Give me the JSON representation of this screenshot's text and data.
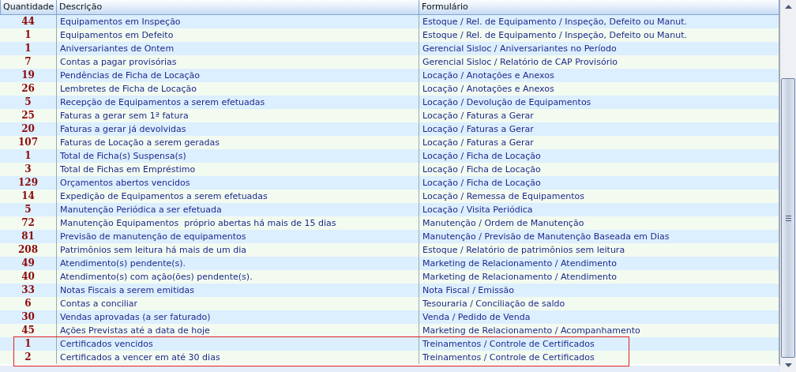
{
  "table": {
    "columns": [
      "Quantidade",
      "Descrição",
      "Formulário"
    ],
    "rows": [
      {
        "quantity": "44",
        "description": "Equipamentos em Inspeção",
        "form": "Estoque / Rel. de Equipamento / Inspeção, Defeito ou Manut.",
        "outlined": false
      },
      {
        "quantity": "1",
        "description": "Equipamentos em Defeito",
        "form": "Estoque / Rel. de Equipamento / Inspeção, Defeito ou Manut.",
        "outlined": false
      },
      {
        "quantity": "1",
        "description": "Aniversariantes de Ontem",
        "form": "Gerencial Sisloc / Aniversariantes no Período",
        "outlined": false
      },
      {
        "quantity": "7",
        "description": "Contas a pagar provisórias",
        "form": "Gerencial Sisloc / Relatório de CAP Provisório",
        "outlined": false
      },
      {
        "quantity": "19",
        "description": "Pendências de Ficha de Locação",
        "form": "Locação / Anotações e Anexos",
        "outlined": false
      },
      {
        "quantity": "26",
        "description": "Lembretes de Ficha de Locação",
        "form": "Locação / Anotações e Anexos",
        "outlined": false
      },
      {
        "quantity": "5",
        "description": "Recepção de Equipamentos a serem efetuadas",
        "form": "Locação / Devolução de Equipamentos",
        "outlined": false
      },
      {
        "quantity": "25",
        "description": "Faturas a gerar sem 1ª fatura",
        "form": "Locação / Faturas a Gerar",
        "outlined": false
      },
      {
        "quantity": "20",
        "description": "Faturas a gerar já devolvidas",
        "form": "Locação / Faturas a Gerar",
        "outlined": false
      },
      {
        "quantity": "107",
        "description": "Faturas de Locação a serem geradas",
        "form": "Locação / Faturas a Gerar",
        "outlined": false
      },
      {
        "quantity": "1",
        "description": "Total de Ficha(s) Suspensa(s)",
        "form": "Locação / Ficha de Locação",
        "outlined": false
      },
      {
        "quantity": "3",
        "description": "Total de Fichas em Empréstimo",
        "form": "Locação / Ficha de Locação",
        "outlined": false
      },
      {
        "quantity": "129",
        "description": "Orçamentos abertos vencidos",
        "form": "Locação / Ficha de Locação",
        "outlined": false
      },
      {
        "quantity": "14",
        "description": "Expedição de Equipamentos a serem efetuadas",
        "form": "Locação / Remessa de Equipamentos",
        "outlined": false
      },
      {
        "quantity": "5",
        "description": "Manutenção Periódica a ser efetuada",
        "form": "Locação / Visita Periódica",
        "outlined": false
      },
      {
        "quantity": "72",
        "description": "Manutenção Equipamentos  próprio abertas há mais de 15 dias",
        "form": "Manutenção / Ordem de Manutenção",
        "outlined": false
      },
      {
        "quantity": "81",
        "description": "Previsão de manutenção de equipamentos",
        "form": "Manutenção / Previsão de Manutenção Baseada em Dias",
        "outlined": false
      },
      {
        "quantity": "208",
        "description": "Patrimônios sem leitura há mais de um dia",
        "form": "Estoque / Relatório de patrimônios sem leitura",
        "outlined": false
      },
      {
        "quantity": "49",
        "description": "Atendimento(s) pendente(s).",
        "form": "Marketing de Relacionamento / Atendimento",
        "outlined": false
      },
      {
        "quantity": "40",
        "description": "Atendimento(s) com ação(ões) pendente(s).",
        "form": "Marketing de Relacionamento / Atendimento",
        "outlined": false
      },
      {
        "quantity": "33",
        "description": "Notas Fiscais a serem emitidas",
        "form": "Nota Fiscal / Emissão",
        "outlined": false
      },
      {
        "quantity": "6",
        "description": "Contas a conciliar",
        "form": "Tesouraria / Conciliação de saldo",
        "outlined": false
      },
      {
        "quantity": "30",
        "description": "Vendas aprovadas (a ser faturado)",
        "form": "Venda / Pedido de Venda",
        "outlined": false
      },
      {
        "quantity": "45",
        "description": "Ações Previstas até a data de hoje",
        "form": "Marketing de Relacionamento / Acompanhamento",
        "outlined": false
      },
      {
        "quantity": "1",
        "description": "Certificados vencidos",
        "form": "Treinamentos / Controle de Certificados",
        "outlined": true
      },
      {
        "quantity": "2",
        "description": "Certificados a vencer em até 30 dias",
        "form": "Treinamentos / Controle de Certificados",
        "outlined": true
      }
    ]
  }
}
